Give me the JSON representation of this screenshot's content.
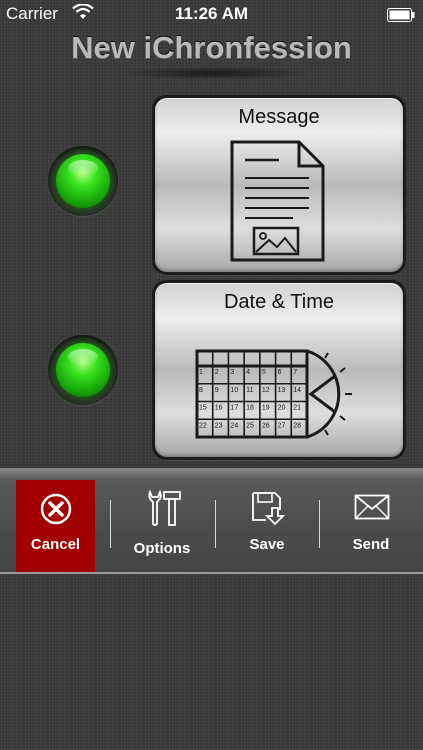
{
  "status_bar": {
    "carrier": "Carrier",
    "time": "11:26 AM"
  },
  "title": "New iChronfession",
  "panels": [
    {
      "label": "Message",
      "icon": "document-image-icon",
      "status": "green"
    },
    {
      "label": "Date & Time",
      "icon": "calendar-clock-icon",
      "status": "green",
      "calendar_days": [
        "1",
        "2",
        "3",
        "4",
        "5",
        "6",
        "7",
        "8",
        "9",
        "10",
        "11",
        "12",
        "13",
        "14",
        "15",
        "16",
        "17",
        "18",
        "19",
        "20",
        "21",
        "22",
        "23",
        "24",
        "25",
        "26",
        "27",
        "28"
      ]
    }
  ],
  "toolbar": {
    "cancel_label": "Cancel",
    "options_label": "Options",
    "save_label": "Save",
    "send_label": "Send"
  },
  "colors": {
    "led_green": "#38e21e",
    "cancel_red": "#a30000",
    "background": "#3a3a3a"
  }
}
